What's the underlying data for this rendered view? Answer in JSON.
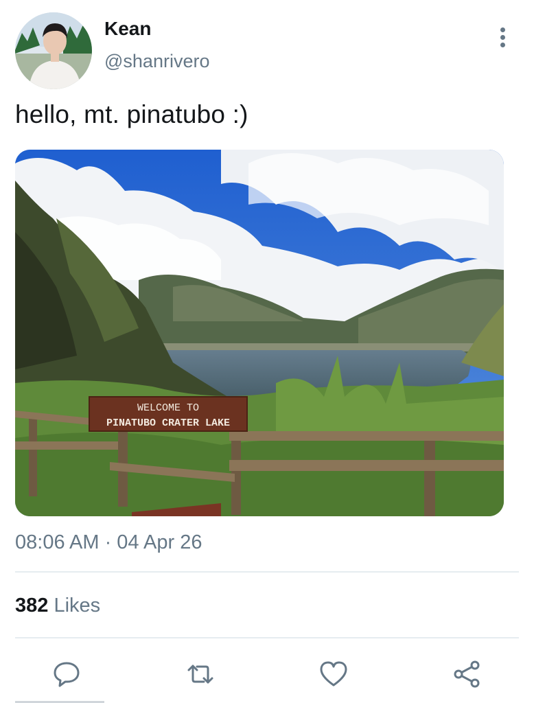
{
  "user": {
    "display_name": "Kean",
    "handle": "@shanrivero"
  },
  "tweet": {
    "text": "hello, mt. pinatubo :)",
    "timestamp": "08:06 AM · 04 Apr 26",
    "image_sign_text": [
      "WELCOME TO",
      "PINATUBO CRATER LAKE"
    ]
  },
  "stats": {
    "likes_count": "382",
    "likes_label": "Likes"
  },
  "actions": {
    "items": [
      "reply-icon",
      "retweet-icon",
      "like-icon",
      "share-icon"
    ]
  },
  "colors": {
    "secondary_text": "#657786",
    "primary_text": "#14171a",
    "divider": "#e6ecf0"
  }
}
